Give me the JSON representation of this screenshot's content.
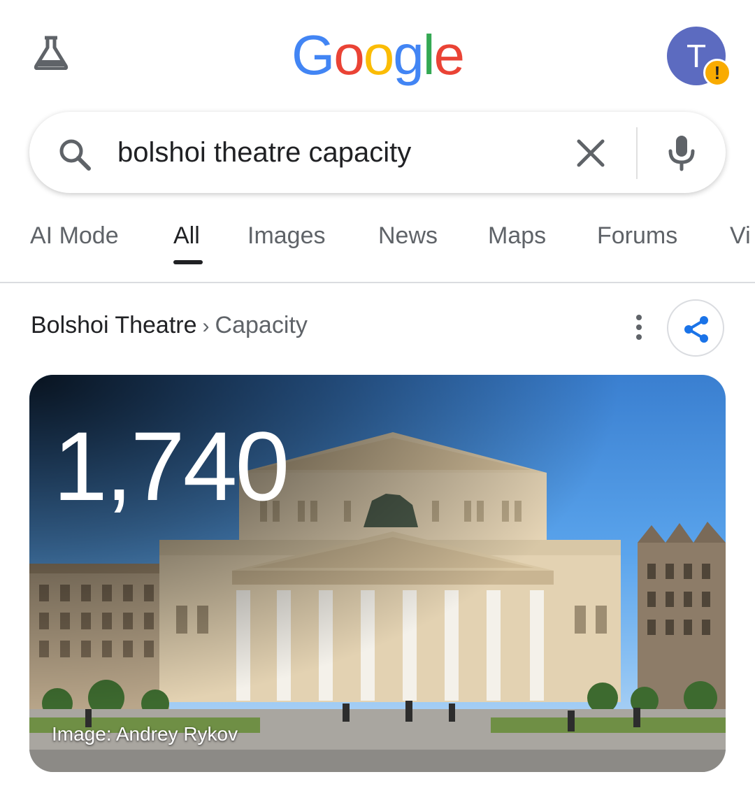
{
  "header": {
    "logo_letters": [
      {
        "ch": "G",
        "color": "#4285F4"
      },
      {
        "ch": "o",
        "color": "#EA4335"
      },
      {
        "ch": "o",
        "color": "#FBBC05"
      },
      {
        "ch": "g",
        "color": "#4285F4"
      },
      {
        "ch": "l",
        "color": "#34A853"
      },
      {
        "ch": "e",
        "color": "#EA4335"
      }
    ],
    "labs_icon": "flask-icon",
    "avatar_initial": "T",
    "avatar_badge": "!"
  },
  "search": {
    "query": "bolshoi theatre capacity",
    "icons": [
      "search-icon",
      "clear-icon",
      "mic-icon"
    ]
  },
  "tabs": [
    {
      "label": "AI Mode"
    },
    {
      "label": "All",
      "active": true
    },
    {
      "label": "Images"
    },
    {
      "label": "News"
    },
    {
      "label": "Maps"
    },
    {
      "label": "Forums"
    },
    {
      "label": "Vi"
    }
  ],
  "result": {
    "breadcrumb_main": "Bolshoi Theatre",
    "breadcrumb_sep": "›",
    "breadcrumb_sub": "Capacity",
    "capacity": "1,740",
    "image_credit": "Image: Andrey Rykov"
  },
  "colors": {
    "accent_blue": "#1a73e8",
    "avatar": "#5c6bc0",
    "badge": "#f9ab00"
  }
}
